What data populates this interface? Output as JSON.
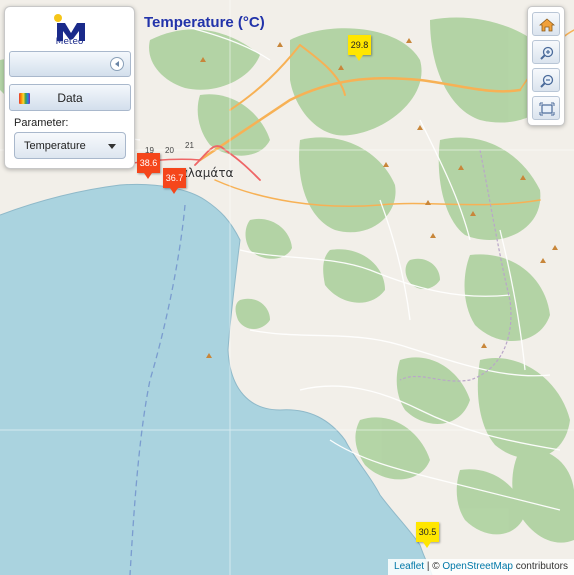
{
  "app": {
    "logo_text": "Meteo",
    "map_title": "Temperature (°C)"
  },
  "panel": {
    "data_button_label": "Data",
    "parameter_label": "Parameter:",
    "parameter_value": "Temperature"
  },
  "map": {
    "city_label": "Καλαμάτα",
    "road_numbers": [
      "19",
      "20",
      "21"
    ],
    "markers": [
      {
        "value": "29.8",
        "level": "warm"
      },
      {
        "value": "38.6",
        "level": "hot"
      },
      {
        "value": "36.7",
        "level": "hot"
      },
      {
        "value": "30.5",
        "level": "warm"
      }
    ]
  },
  "attribution": {
    "leaflet": "Leaflet",
    "separator": "| ©",
    "osm": "OpenStreetMap",
    "contributors": "contributors"
  },
  "colors": {
    "sea": "#aad3df",
    "land": "#f2efe9",
    "forest": "#add19e",
    "hot_marker": "#f5461b",
    "warm_marker": "#ffe600",
    "title": "#2233aa"
  },
  "icons": [
    "home-icon",
    "zoom-in-icon",
    "zoom-out-icon",
    "fit-extent-icon",
    "collapse-arrow-icon",
    "rainbow-icon"
  ]
}
